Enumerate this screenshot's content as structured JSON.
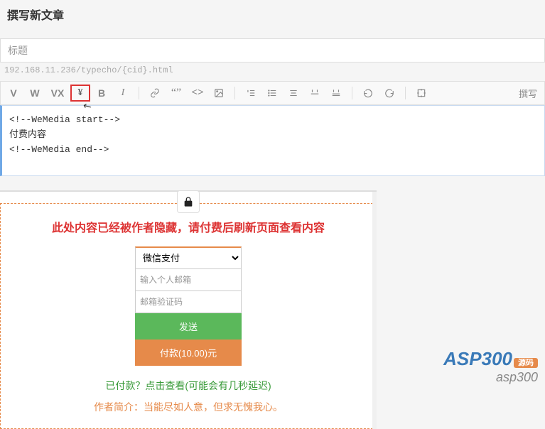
{
  "header": {
    "title": "撰写新文章"
  },
  "titleField": {
    "placeholder": "标题"
  },
  "urlPreview": "192.168.11.236/typecho/{cid}.html",
  "toolbar": {
    "v": "V",
    "w": "W",
    "vx": "VX",
    "yen": "¥",
    "b": "B",
    "i": "I",
    "writeMode": "撰写"
  },
  "editor": {
    "line1": "<!--WeMedia start-->",
    "line2": "付费内容",
    "line3": "<!--WeMedia end-->"
  },
  "paywall": {
    "notice": "此处内容已经被作者隐藏，请付费后刷新页面查看内容",
    "payMethod": "微信支付",
    "emailPlaceholder": "输入个人邮箱",
    "codePlaceholder": "邮箱验证码",
    "sendBtn": "发送",
    "payBtn": "付款(10.00)元",
    "paidLink": "已付款？点击查看(可能会有几秒延迟)",
    "authorBio": "作者简介：当能尽如人意，但求无愧我心。"
  },
  "watermark": {
    "brand": "ASP300",
    "badge": "源码",
    "sub": "asp300"
  }
}
